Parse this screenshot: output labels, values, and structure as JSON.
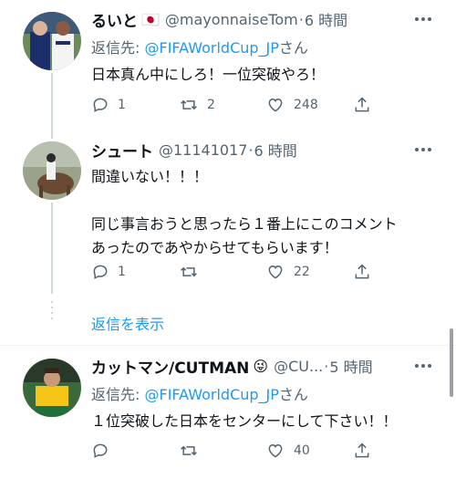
{
  "tweets": [
    {
      "name": "るいと",
      "flag": "🇯🇵",
      "handle": "@mayonnaiseTom",
      "dot": "·",
      "time": "6 時間",
      "reply_prefix": "返信先: ",
      "reply_handle": "@FIFAWorldCup_JP",
      "reply_suffix": "さん",
      "lines": [
        "日本真ん中にしろ！一位突破やろ！"
      ],
      "replies": "1",
      "retweets": "2",
      "likes": "248"
    },
    {
      "name": "シュート",
      "handle": "@11141017",
      "dot": "·",
      "time": "6 時間",
      "lines": [
        "間違いない！！！",
        "",
        "同じ事言おうと思ったら１番上にこのコメント",
        "あったのであやからせてもらいます！"
      ],
      "replies": "1",
      "retweets": "",
      "likes": "22"
    },
    {
      "name": "カットマン/CUTMAN",
      "emoji": "😜",
      "handle": "@CU...",
      "dot": "·",
      "time": "5 時間",
      "reply_prefix": "返信先: ",
      "reply_handle": "@FIFAWorldCup_JP",
      "reply_suffix": "さん",
      "lines": [
        "１位突破した日本をセンターにして下さい！！"
      ],
      "replies": "",
      "retweets": "",
      "likes": "40"
    }
  ],
  "show_replies": "返信を表示",
  "icons": {
    "reply": "reply-icon",
    "retweet": "retweet-icon",
    "like": "heart-icon",
    "share": "share-icon",
    "more": "more-icon"
  },
  "colors": {
    "link": "#1d9bf0",
    "secondary": "#536471",
    "text": "#0f1419"
  }
}
